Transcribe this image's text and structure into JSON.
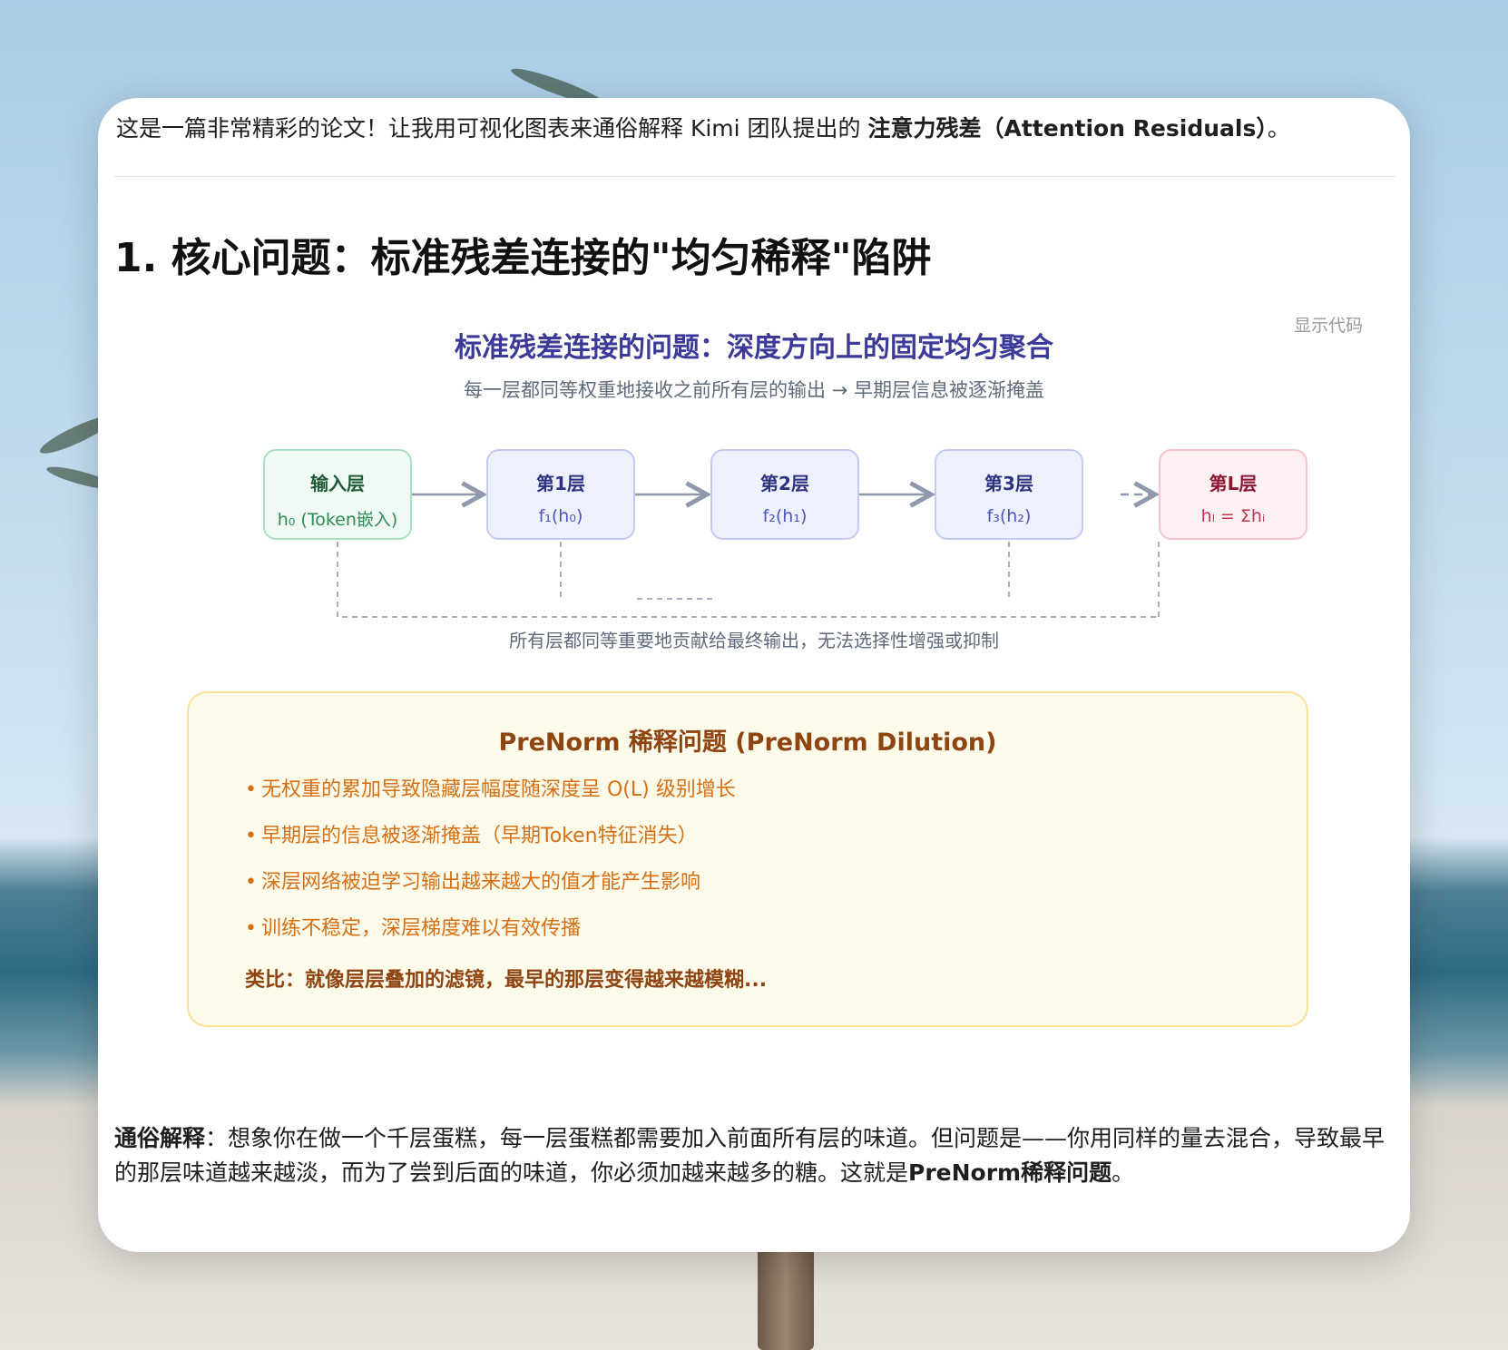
{
  "intro": {
    "prefix": "这是一篇非常精彩的论文！让我用可视化图表来通俗解释 Kimi 团队提出的 ",
    "highlight": "注意力残差（Attention Residuals）",
    "suffix": "。"
  },
  "section": {
    "title": "1. 核心问题：标准残差连接的\"均匀稀释\"陷阱"
  },
  "toolbar": {
    "show_code": "显示代码"
  },
  "figure": {
    "title": "标准残差连接的问题：深度方向上的固定均匀聚合",
    "subtitle": "每一层都同等权重地接收之前所有层的输出 → 早期层信息被逐渐掩盖",
    "nodes": [
      {
        "title": "输入层",
        "formula": "h₀ (Token嵌入)"
      },
      {
        "title": "第1层",
        "formula": "f₁(h₀)"
      },
      {
        "title": "第2层",
        "formula": "f₂(h₁)"
      },
      {
        "title": "第3层",
        "formula": "f₃(h₂)"
      },
      {
        "title": "第L层",
        "formula": "hₗ = Σhᵢ"
      }
    ],
    "caption": "所有层都同等重要地贡献给最终输出，无法选择性增强或抑制",
    "colors": {
      "input": "#2f8b55",
      "layer": "#4b56c4",
      "final": "#c43454",
      "arrow": "#8e99ab"
    }
  },
  "warning": {
    "title": "PreNorm 稀释问题 (PreNorm Dilution)",
    "bullet": "•",
    "items": [
      "无权重的累加导致隐藏层幅度随深度呈 O(L) 级别增长",
      "早期层的信息被逐渐掩盖（早期Token特征消失）",
      "深层网络被迫学习输出越来越大的值才能产生影响",
      "训练不稳定，深层梯度难以有效传播"
    ],
    "analogy": "类比：就像层层叠加的滤镜，最早的那层变得越来越模糊..."
  },
  "explanation": {
    "label": "通俗解释",
    "text": "：想象你在做一个千层蛋糕，每一层蛋糕都需要加入前面所有层的味道。但问题是——你用同样的量去混合，导致最早的那层味道越来越淡，而为了尝到后面的味道，你必须加越来越多的糖。这就是",
    "highlight": "PreNorm稀释问题",
    "suffix": "。"
  }
}
